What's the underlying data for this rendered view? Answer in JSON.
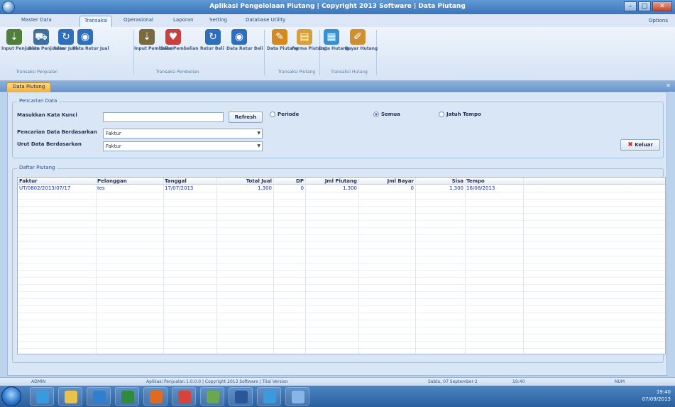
{
  "window": {
    "title": "Aplikasi Pengelolaan Piutang | Copyright 2013 Software | Data Piutang"
  },
  "menu": {
    "tabs": [
      "Master Data",
      "Transaksi",
      "Operasional",
      "Laporan",
      "Setting",
      "Database Utility"
    ],
    "active_tab": "Transaksi",
    "right": "Options"
  },
  "ribbon": {
    "buttons": [
      {
        "label": "Input Penjualan",
        "icon": "cart-in-icon",
        "color": "#4f7f3a"
      },
      {
        "label": "Data Penjualan",
        "icon": "shopping-cart-icon",
        "color": "#3f6f9f"
      },
      {
        "label": "Retur Jual",
        "icon": "refresh-icon",
        "color": "#2f6dbd"
      },
      {
        "label": "Data Retur Jual",
        "icon": "database-icon",
        "color": "#2f6dbd"
      },
      {
        "label": "Input Pembelian",
        "icon": "cart-in-icon",
        "color": "#7a6a40"
      },
      {
        "label": "Data Pembelian",
        "icon": "heart-cart-icon",
        "color": "#c94040"
      },
      {
        "label": "Retur Beli",
        "icon": "refresh-icon",
        "color": "#2f6dbd"
      },
      {
        "label": "Data Retur Beli",
        "icon": "database-icon",
        "color": "#2f6dbd"
      },
      {
        "label": "Data Piutang",
        "icon": "notepad-icon",
        "color": "#d48a20"
      },
      {
        "label": "Forma Piutang",
        "icon": "clipboard-icon",
        "color": "#d4a040"
      },
      {
        "label": "Data Hutang",
        "icon": "calendar-icon",
        "color": "#3a8fd0"
      },
      {
        "label": "Bayar Hutang",
        "icon": "pencil-icon",
        "color": "#d09030"
      }
    ],
    "groups": [
      "Transaksi Penjualan",
      "Transaksi Pembelian",
      "Transaksi Piutang",
      "Transaksi Hutang"
    ]
  },
  "doc_tab": {
    "label": "Data Piutang"
  },
  "search": {
    "legend": "Pencarian Data",
    "keyword_label": "Masukkan Kata Kunci",
    "keyword_value": "",
    "refresh_label": "Refresh",
    "search_by_label": "Pencarian Data Berdasarkan",
    "search_by_value": "Faktur",
    "sort_by_label": "Urut Data Berdasarkan",
    "sort_by_value": "Faktur",
    "radios": [
      {
        "label": "Periode",
        "checked": false
      },
      {
        "label": "Semua",
        "checked": true
      },
      {
        "label": "Jatuh Tempo",
        "checked": false
      }
    ],
    "close_label": "Keluar"
  },
  "table": {
    "legend": "Daftar Piutang",
    "columns": [
      "Faktur",
      "Pelanggan",
      "Tanggal",
      "Total Jual",
      "DP",
      "Jml Piutang",
      "Jml Bayar",
      "Sisa",
      "Tempo"
    ],
    "rows": [
      [
        "UT/0802/2013/07/17",
        "tes",
        "17/07/2013",
        "1.300",
        "0",
        "1.300",
        "0",
        "1.300",
        "16/08/2013"
      ]
    ]
  },
  "status": {
    "user": "ADMIN",
    "app": "Aplikasi Penjualan 1.0.0.0 | Copyright 2013 Software | Trial Version",
    "date": "Sabtu, 07 September 2",
    "time": "19:40",
    "mode": "NUM"
  },
  "taskbar": {
    "apps": [
      {
        "icon": "ie-icon",
        "color": "#3a9ae0"
      },
      {
        "icon": "folder-icon",
        "color": "#e8c24a"
      },
      {
        "icon": "media-player-icon",
        "color": "#2e7fd0"
      },
      {
        "icon": "excel-app-icon",
        "color": "#2e8b3e"
      },
      {
        "icon": "firefox-icon",
        "color": "#e06a1e"
      },
      {
        "icon": "chrome-icon",
        "color": "#d9443a"
      },
      {
        "icon": "green-app-icon",
        "color": "#6aa84f"
      },
      {
        "icon": "word-icon",
        "color": "#2b579a"
      },
      {
        "icon": "ie2-icon",
        "color": "#3a9ae0"
      },
      {
        "icon": "app-icon",
        "color": "#86b6e8"
      }
    ],
    "clock": "19:40",
    "date": "07/09/2013"
  }
}
